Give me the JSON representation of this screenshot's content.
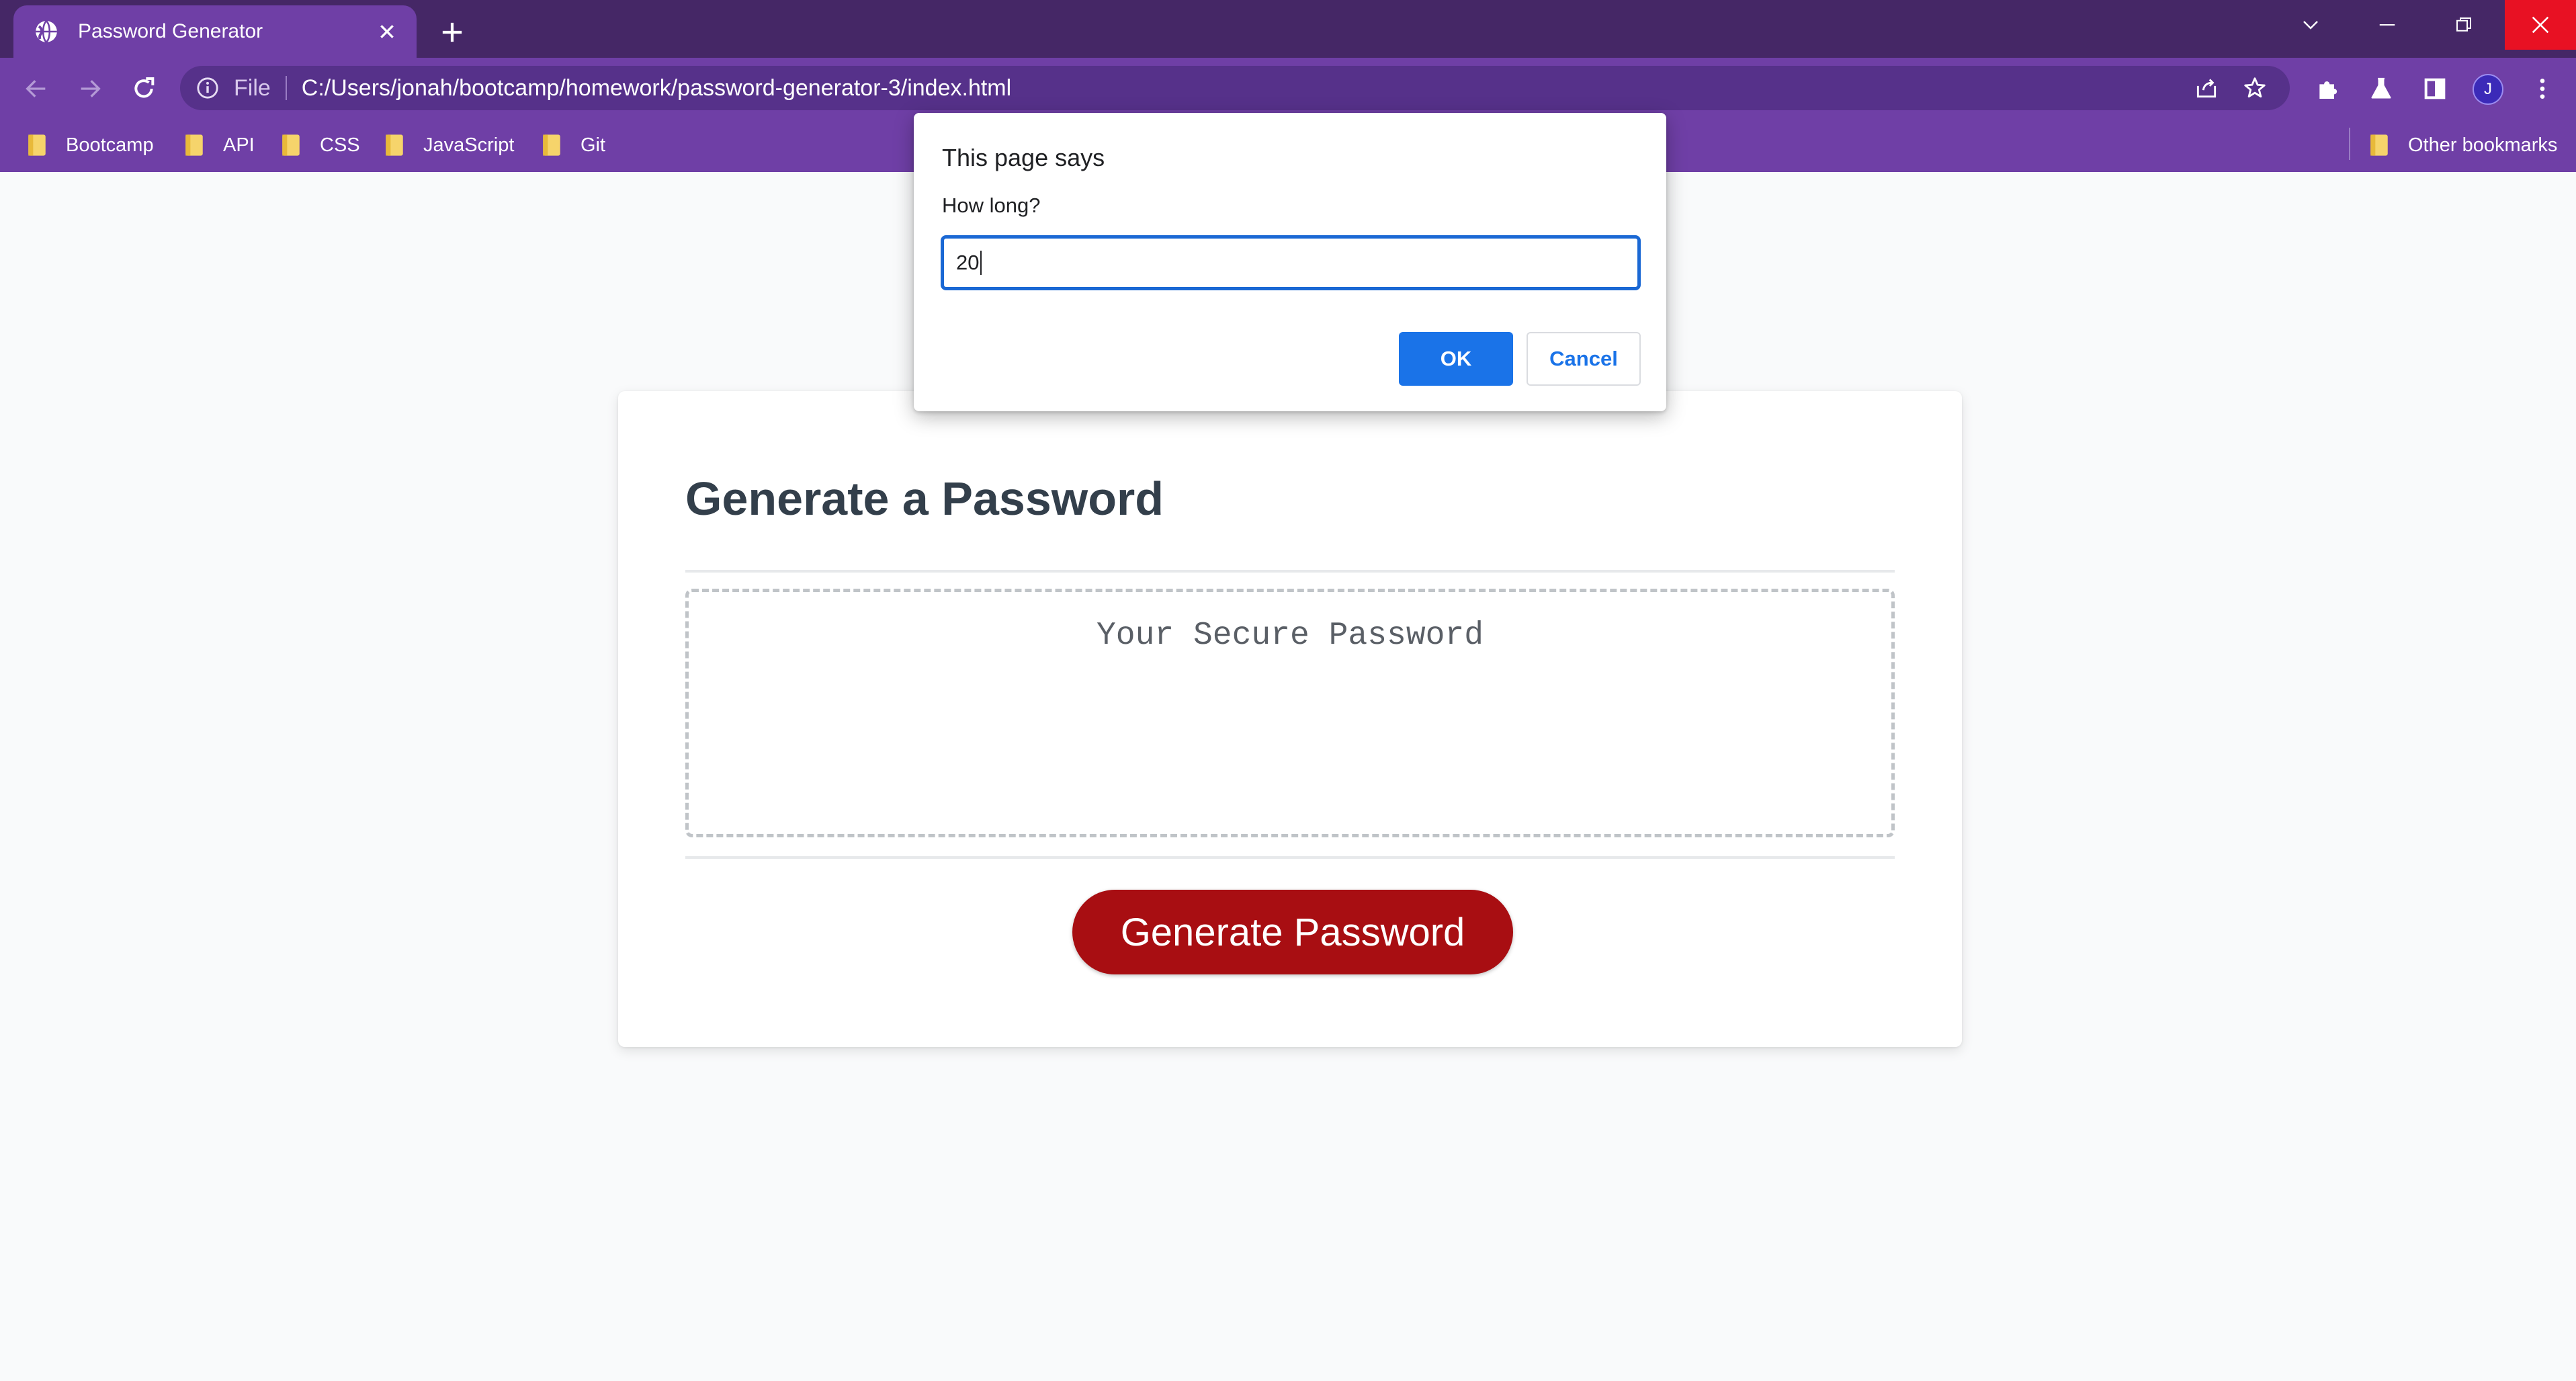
{
  "browser": {
    "tab": {
      "title": "Password Generator"
    },
    "address": {
      "scheme_label": "File",
      "url": "C:/Users/jonah/bootcamp/homework/password-generator-3/index.html"
    },
    "profile_initial": "J",
    "bookmarks": [
      {
        "label": "Bootcamp"
      },
      {
        "label": "API"
      },
      {
        "label": "CSS"
      },
      {
        "label": "JavaScript"
      },
      {
        "label": "Git"
      }
    ],
    "other_bookmarks": "Other bookmarks",
    "colors": {
      "frame": "#452766",
      "toolbar": "#6f3fa6",
      "close": "#e81123"
    }
  },
  "page": {
    "heading": "Generate a Password",
    "password_placeholder": "Your Secure Password",
    "generate_button": "Generate Password",
    "colors": {
      "button": "#a80e12",
      "heading": "#333f4b"
    }
  },
  "dialog": {
    "title": "This page says",
    "message": "How long?",
    "input_value": "20",
    "ok_label": "OK",
    "cancel_label": "Cancel",
    "colors": {
      "primary": "#1a73e8"
    }
  }
}
